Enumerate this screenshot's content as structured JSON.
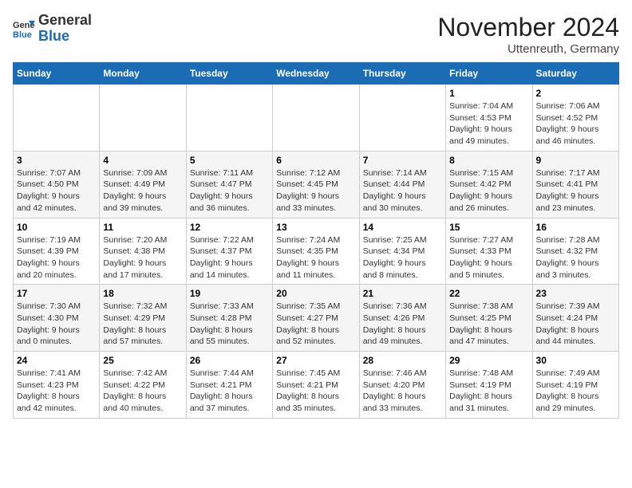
{
  "header": {
    "logo_line1": "General",
    "logo_line2": "Blue",
    "month": "November 2024",
    "location": "Uttenreuth, Germany"
  },
  "weekdays": [
    "Sunday",
    "Monday",
    "Tuesday",
    "Wednesday",
    "Thursday",
    "Friday",
    "Saturday"
  ],
  "weeks": [
    [
      {
        "day": "",
        "info": ""
      },
      {
        "day": "",
        "info": ""
      },
      {
        "day": "",
        "info": ""
      },
      {
        "day": "",
        "info": ""
      },
      {
        "day": "",
        "info": ""
      },
      {
        "day": "1",
        "info": "Sunrise: 7:04 AM\nSunset: 4:53 PM\nDaylight: 9 hours\nand 49 minutes."
      },
      {
        "day": "2",
        "info": "Sunrise: 7:06 AM\nSunset: 4:52 PM\nDaylight: 9 hours\nand 46 minutes."
      }
    ],
    [
      {
        "day": "3",
        "info": "Sunrise: 7:07 AM\nSunset: 4:50 PM\nDaylight: 9 hours\nand 42 minutes."
      },
      {
        "day": "4",
        "info": "Sunrise: 7:09 AM\nSunset: 4:49 PM\nDaylight: 9 hours\nand 39 minutes."
      },
      {
        "day": "5",
        "info": "Sunrise: 7:11 AM\nSunset: 4:47 PM\nDaylight: 9 hours\nand 36 minutes."
      },
      {
        "day": "6",
        "info": "Sunrise: 7:12 AM\nSunset: 4:45 PM\nDaylight: 9 hours\nand 33 minutes."
      },
      {
        "day": "7",
        "info": "Sunrise: 7:14 AM\nSunset: 4:44 PM\nDaylight: 9 hours\nand 30 minutes."
      },
      {
        "day": "8",
        "info": "Sunrise: 7:15 AM\nSunset: 4:42 PM\nDaylight: 9 hours\nand 26 minutes."
      },
      {
        "day": "9",
        "info": "Sunrise: 7:17 AM\nSunset: 4:41 PM\nDaylight: 9 hours\nand 23 minutes."
      }
    ],
    [
      {
        "day": "10",
        "info": "Sunrise: 7:19 AM\nSunset: 4:39 PM\nDaylight: 9 hours\nand 20 minutes."
      },
      {
        "day": "11",
        "info": "Sunrise: 7:20 AM\nSunset: 4:38 PM\nDaylight: 9 hours\nand 17 minutes."
      },
      {
        "day": "12",
        "info": "Sunrise: 7:22 AM\nSunset: 4:37 PM\nDaylight: 9 hours\nand 14 minutes."
      },
      {
        "day": "13",
        "info": "Sunrise: 7:24 AM\nSunset: 4:35 PM\nDaylight: 9 hours\nand 11 minutes."
      },
      {
        "day": "14",
        "info": "Sunrise: 7:25 AM\nSunset: 4:34 PM\nDaylight: 9 hours\nand 8 minutes."
      },
      {
        "day": "15",
        "info": "Sunrise: 7:27 AM\nSunset: 4:33 PM\nDaylight: 9 hours\nand 5 minutes."
      },
      {
        "day": "16",
        "info": "Sunrise: 7:28 AM\nSunset: 4:32 PM\nDaylight: 9 hours\nand 3 minutes."
      }
    ],
    [
      {
        "day": "17",
        "info": "Sunrise: 7:30 AM\nSunset: 4:30 PM\nDaylight: 9 hours\nand 0 minutes."
      },
      {
        "day": "18",
        "info": "Sunrise: 7:32 AM\nSunset: 4:29 PM\nDaylight: 8 hours\nand 57 minutes."
      },
      {
        "day": "19",
        "info": "Sunrise: 7:33 AM\nSunset: 4:28 PM\nDaylight: 8 hours\nand 55 minutes."
      },
      {
        "day": "20",
        "info": "Sunrise: 7:35 AM\nSunset: 4:27 PM\nDaylight: 8 hours\nand 52 minutes."
      },
      {
        "day": "21",
        "info": "Sunrise: 7:36 AM\nSunset: 4:26 PM\nDaylight: 8 hours\nand 49 minutes."
      },
      {
        "day": "22",
        "info": "Sunrise: 7:38 AM\nSunset: 4:25 PM\nDaylight: 8 hours\nand 47 minutes."
      },
      {
        "day": "23",
        "info": "Sunrise: 7:39 AM\nSunset: 4:24 PM\nDaylight: 8 hours\nand 44 minutes."
      }
    ],
    [
      {
        "day": "24",
        "info": "Sunrise: 7:41 AM\nSunset: 4:23 PM\nDaylight: 8 hours\nand 42 minutes."
      },
      {
        "day": "25",
        "info": "Sunrise: 7:42 AM\nSunset: 4:22 PM\nDaylight: 8 hours\nand 40 minutes."
      },
      {
        "day": "26",
        "info": "Sunrise: 7:44 AM\nSunset: 4:21 PM\nDaylight: 8 hours\nand 37 minutes."
      },
      {
        "day": "27",
        "info": "Sunrise: 7:45 AM\nSunset: 4:21 PM\nDaylight: 8 hours\nand 35 minutes."
      },
      {
        "day": "28",
        "info": "Sunrise: 7:46 AM\nSunset: 4:20 PM\nDaylight: 8 hours\nand 33 minutes."
      },
      {
        "day": "29",
        "info": "Sunrise: 7:48 AM\nSunset: 4:19 PM\nDaylight: 8 hours\nand 31 minutes."
      },
      {
        "day": "30",
        "info": "Sunrise: 7:49 AM\nSunset: 4:19 PM\nDaylight: 8 hours\nand 29 minutes."
      }
    ]
  ]
}
